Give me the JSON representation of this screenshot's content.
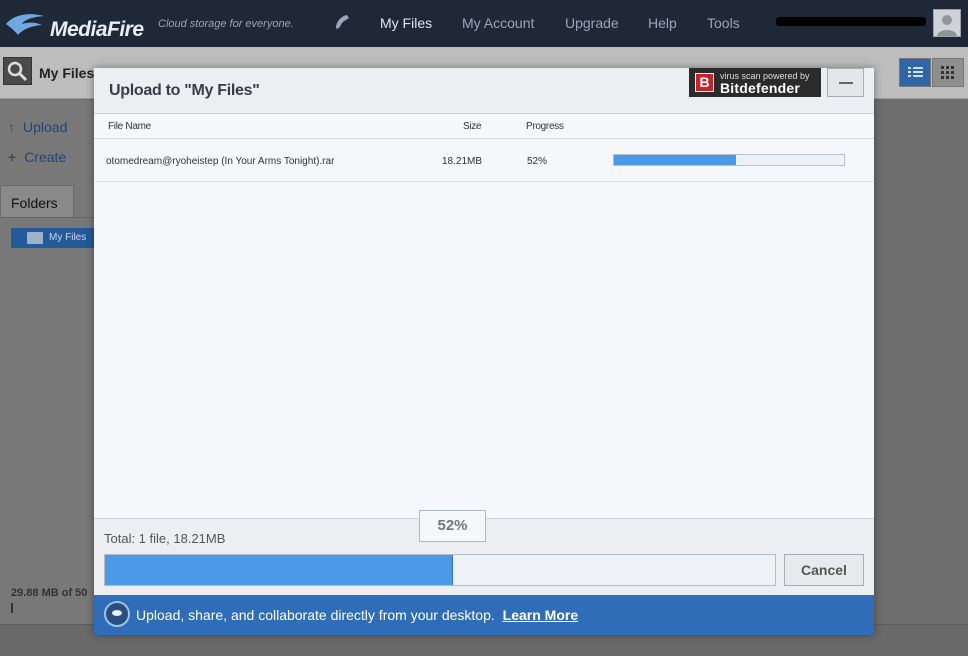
{
  "header": {
    "brand": "MediaFire",
    "tagline": "Cloud storage for everyone.",
    "nav": [
      {
        "label": "My Files",
        "active": true
      },
      {
        "label": "My Account",
        "active": false
      },
      {
        "label": "Upgrade",
        "active": false
      },
      {
        "label": "Help",
        "active": false
      },
      {
        "label": "Tools",
        "active": false
      }
    ]
  },
  "toolbar": {
    "location_title": "My Files"
  },
  "sidebar": {
    "upload_label": "Upload",
    "create_label": "Create",
    "folders_tab": "Folders",
    "root_folder": "My Files",
    "storage_text": "29.88 MB of 50"
  },
  "upload_dialog": {
    "title": "Upload to \"My Files\"",
    "virus_scan_small": "virus scan powered by",
    "virus_scan_brand": "Bitdefender",
    "columns": {
      "name": "File Name",
      "size": "Size",
      "progress": "Progress"
    },
    "files": [
      {
        "name": "otomedream@ryoheistep (In Your Arms Tonight).rar",
        "size": "18.21MB",
        "progress": "52%",
        "progress_fraction": 0.53
      }
    ],
    "total_text": "Total: 1 file, 18.21MB",
    "total_progress_text": "52%",
    "total_progress_fraction": 0.52,
    "cancel_label": "Cancel",
    "promo_text": "Upload, share, and collaborate directly from your desktop.",
    "promo_link": "Learn More"
  },
  "colors": {
    "topbar": "#1f2836",
    "progress_fill": "#4b9ae8",
    "promo_bar": "#2f6db8",
    "bitdefender_red": "#c91f25"
  }
}
